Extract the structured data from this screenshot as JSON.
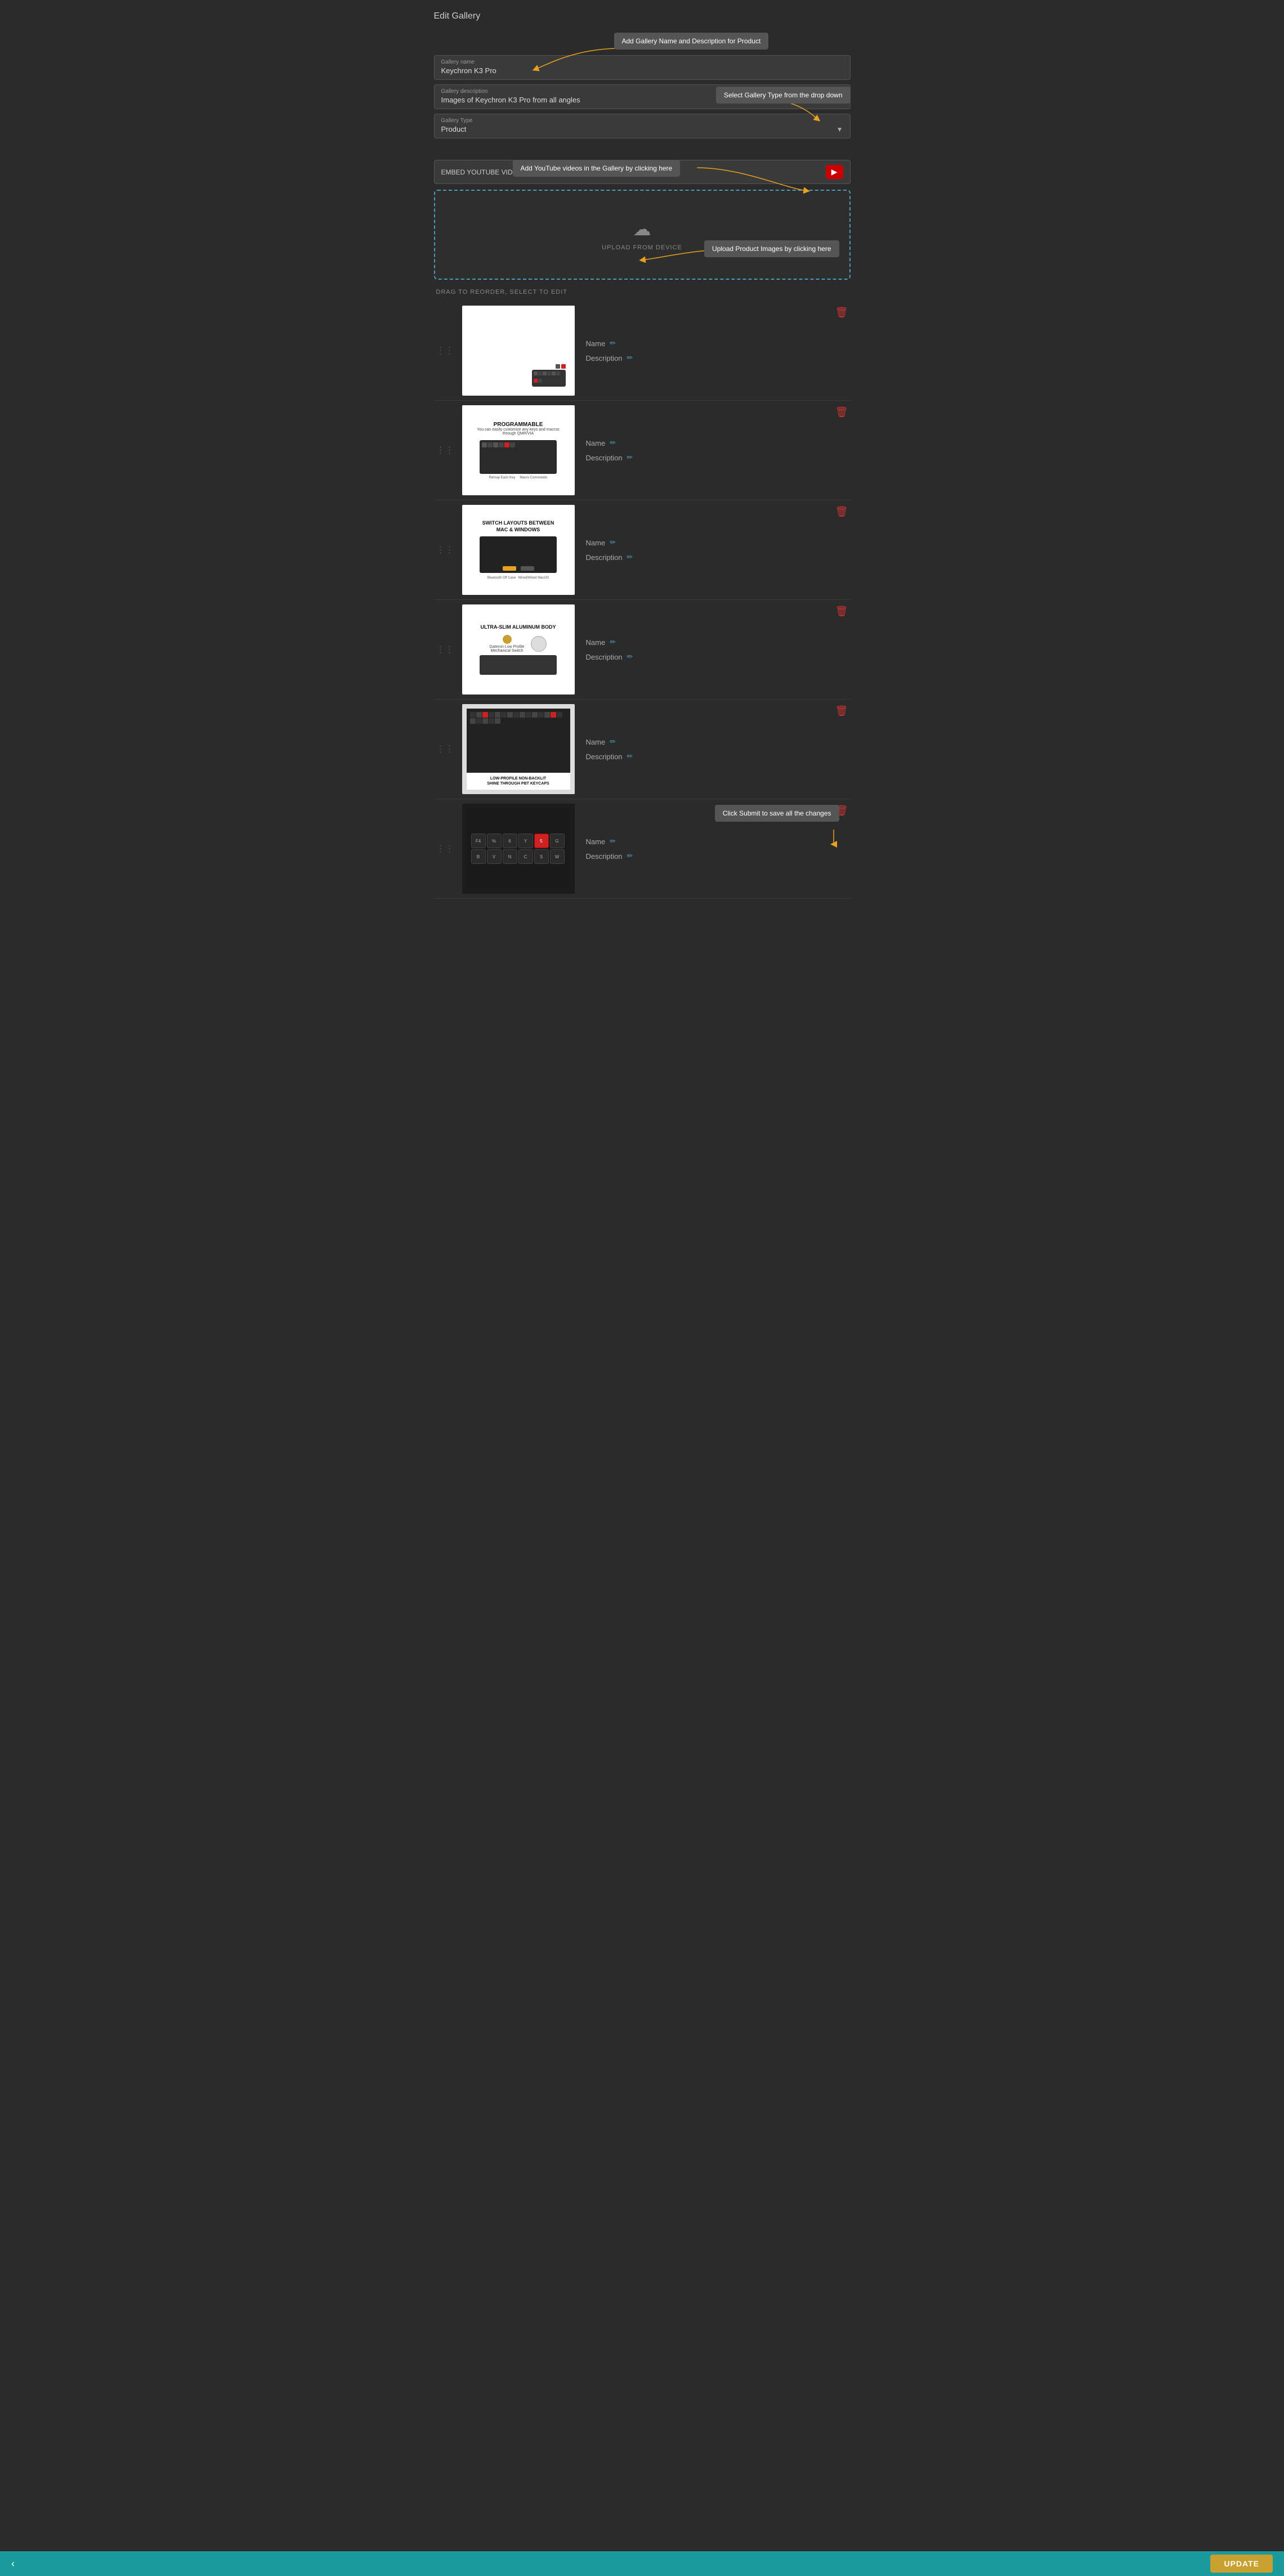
{
  "page": {
    "title": "Edit Gallery"
  },
  "callouts": {
    "gallery_name_desc": "Add Gallery Name and Description for Product",
    "gallery_type": "Select Gallery Type from the drop down",
    "youtube": "Add YouTube videos in the Gallery by clicking here",
    "upload": "Upload Product Images by clicking here",
    "submit": "Click Submit to save all the changes"
  },
  "form": {
    "gallery_name_label": "Gallery name",
    "gallery_name_value": "Keychron K3 Pro",
    "gallery_desc_label": "Gallery description",
    "gallery_desc_value": "Images of Keychron K3 Pro from all angles",
    "gallery_type_label": "Gallery Type",
    "gallery_type_value": "Product"
  },
  "youtube": {
    "label": "EMBED YOUTUBE VIDEO",
    "button_icon": "▶"
  },
  "upload": {
    "icon": "☁",
    "text": "UPLOAD FROM DEVICE"
  },
  "drag_label": "DRAG TO REORDER, SELECT TO EDIT",
  "images": [
    {
      "id": 1,
      "name_label": "Name",
      "desc_label": "Description",
      "thumb_type": "kb1"
    },
    {
      "id": 2,
      "name_label": "Name",
      "desc_label": "Description",
      "thumb_type": "kb2"
    },
    {
      "id": 3,
      "name_label": "Name",
      "desc_label": "Description",
      "thumb_type": "kb3"
    },
    {
      "id": 4,
      "name_label": "Name",
      "desc_label": "Description",
      "thumb_type": "kb4"
    },
    {
      "id": 5,
      "name_label": "Name",
      "desc_label": "Description",
      "thumb_type": "kb5"
    },
    {
      "id": 6,
      "name_label": "Name",
      "desc_label": "Description",
      "thumb_type": "kb6"
    }
  ],
  "bottom": {
    "back_icon": "‹",
    "update_label": "UPDATE"
  },
  "colors": {
    "accent_orange": "#e8a020",
    "accent_teal": "#1a9a9a",
    "accent_blue": "#4a9aba",
    "delete_red": "#cc3333",
    "youtube_red": "#cc0000",
    "callout_bg": "#555555"
  }
}
